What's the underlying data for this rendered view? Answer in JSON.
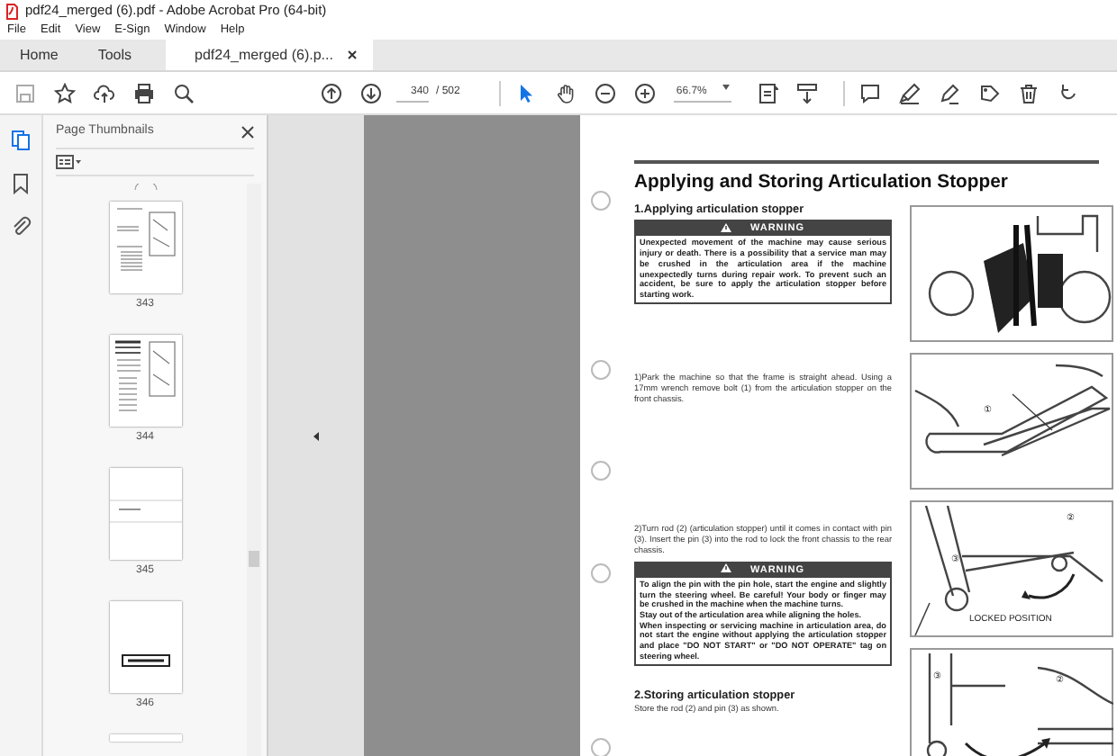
{
  "window": {
    "title": "pdf24_merged (6).pdf - Adobe Acrobat Pro (64-bit)"
  },
  "menu": [
    "File",
    "Edit",
    "View",
    "E-Sign",
    "Window",
    "Help"
  ],
  "tabs": [
    {
      "label": "Home",
      "selected": false,
      "closable": false
    },
    {
      "label": "Tools",
      "selected": false,
      "closable": false
    },
    {
      "label": "pdf24_merged (6).p...",
      "selected": true,
      "closable": true
    }
  ],
  "toolbar": {
    "page_current": "340",
    "page_total": "/ 502",
    "zoom": "66.7%"
  },
  "sidebar": {
    "tools": [
      {
        "kind": "pages",
        "selected": true
      },
      {
        "kind": "bookmark",
        "selected": false
      },
      {
        "kind": "attachment",
        "selected": false
      }
    ]
  },
  "thumbnails_panel": {
    "title": "Page Thumbnails",
    "pages": [
      {
        "label": "343",
        "kind": "figures"
      },
      {
        "label": "344",
        "kind": "table"
      },
      {
        "label": "345",
        "kind": "band"
      },
      {
        "label": "346",
        "kind": "label"
      }
    ]
  },
  "document": {
    "title": "Applying and Storing Articulation Stopper",
    "blocks": [
      {
        "kind": "heading",
        "text": "1.Applying articulation stopper"
      },
      {
        "kind": "warning",
        "header": "WARNING",
        "paragraphs": [
          "Unexpected movement of the machine may cause serious injury or death. There is a possibility that a service man may be crushed in the articulation area if the machine unexpectedly turns during repair work. To prevent such an accident, be sure to apply the articulation stopper before starting work."
        ]
      },
      {
        "kind": "step",
        "text": "1)Park the machine so that the frame is straight ahead. Using a 17mm wrench remove bolt (1) from the articulation stopper on the front chassis."
      },
      {
        "kind": "step",
        "text": "2)Turn rod (2) (articulation stopper) until it comes in contact with pin (3). Insert the pin (3) into the rod to lock the front chassis to the rear chassis."
      },
      {
        "kind": "warning",
        "header": "WARNING",
        "paragraphs": [
          "To align the pin with the pin hole, start the engine and slightly turn the steering wheel. Be careful! Your body or finger may be crushed in the machine when the machine turns.",
          "Stay out of the articulation area while aligning the holes.",
          "When inspecting or servicing machine in articulation area, do not start the engine without applying the articulation stopper and place \"DO NOT START\" or \"DO NOT OPERATE\" tag on steering wheel."
        ]
      },
      {
        "kind": "heading",
        "text": "2.Storing articulation stopper"
      },
      {
        "kind": "step",
        "text": "Store the rod (2) and pin (3) as shown."
      }
    ],
    "figures": [
      {
        "kind": "machine"
      },
      {
        "kind": "bolt",
        "labels": [
          "①"
        ]
      },
      {
        "kind": "locked",
        "labels": [
          "②",
          "③",
          "LOCKED POSITION"
        ]
      },
      {
        "kind": "stored",
        "labels": [
          "③",
          "②"
        ]
      }
    ]
  }
}
